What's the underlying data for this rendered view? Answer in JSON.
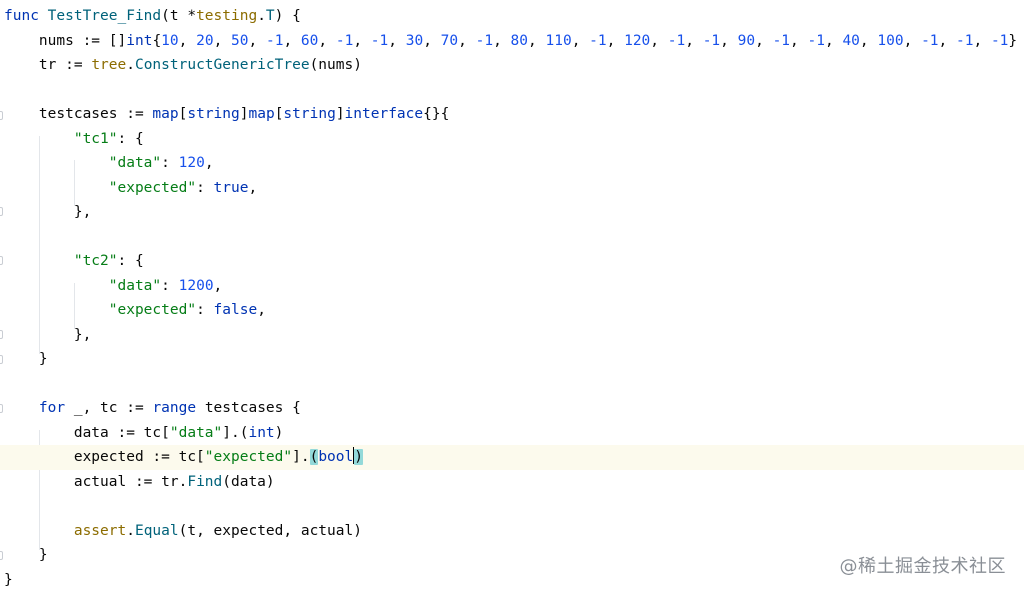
{
  "editor": {
    "lines": [
      {
        "indent": 0,
        "tokens": [
          [
            "kw",
            "func"
          ],
          [
            "plain",
            " "
          ],
          [
            "fn",
            "TestTree_Find"
          ],
          [
            "plain",
            "(t *"
          ],
          [
            "pkg",
            "testing"
          ],
          [
            "plain",
            "."
          ],
          [
            "fncall",
            "T"
          ],
          [
            "plain",
            ") {"
          ]
        ]
      },
      {
        "indent": 1,
        "tokens": [
          [
            "plain",
            "nums := []"
          ],
          [
            "type",
            "int"
          ],
          [
            "plain",
            "{"
          ],
          [
            "num",
            "10"
          ],
          [
            "plain",
            ", "
          ],
          [
            "num",
            "20"
          ],
          [
            "plain",
            ", "
          ],
          [
            "num",
            "50"
          ],
          [
            "plain",
            ", "
          ],
          [
            "num",
            "-1"
          ],
          [
            "plain",
            ", "
          ],
          [
            "num",
            "60"
          ],
          [
            "plain",
            ", "
          ],
          [
            "num",
            "-1"
          ],
          [
            "plain",
            ", "
          ],
          [
            "num",
            "-1"
          ],
          [
            "plain",
            ", "
          ],
          [
            "num",
            "30"
          ],
          [
            "plain",
            ", "
          ],
          [
            "num",
            "70"
          ],
          [
            "plain",
            ", "
          ],
          [
            "num",
            "-1"
          ],
          [
            "plain",
            ", "
          ],
          [
            "num",
            "80"
          ],
          [
            "plain",
            ", "
          ],
          [
            "num",
            "110"
          ],
          [
            "plain",
            ", "
          ],
          [
            "num",
            "-1"
          ],
          [
            "plain",
            ", "
          ],
          [
            "num",
            "120"
          ],
          [
            "plain",
            ", "
          ],
          [
            "num",
            "-1"
          ],
          [
            "plain",
            ", "
          ],
          [
            "num",
            "-1"
          ],
          [
            "plain",
            ", "
          ],
          [
            "num",
            "90"
          ],
          [
            "plain",
            ", "
          ],
          [
            "num",
            "-1"
          ],
          [
            "plain",
            ", "
          ],
          [
            "num",
            "-1"
          ],
          [
            "plain",
            ", "
          ],
          [
            "num",
            "40"
          ],
          [
            "plain",
            ", "
          ],
          [
            "num",
            "100"
          ],
          [
            "plain",
            ", "
          ],
          [
            "num",
            "-1"
          ],
          [
            "plain",
            ", "
          ],
          [
            "num",
            "-1"
          ],
          [
            "plain",
            ", "
          ],
          [
            "num",
            "-1"
          ],
          [
            "plain",
            "}"
          ]
        ]
      },
      {
        "indent": 1,
        "tokens": [
          [
            "plain",
            "tr := "
          ],
          [
            "pkg",
            "tree"
          ],
          [
            "plain",
            "."
          ],
          [
            "fncall",
            "ConstructGenericTree"
          ],
          [
            "plain",
            "(nums)"
          ]
        ]
      },
      {
        "indent": 0,
        "tokens": []
      },
      {
        "indent": 1,
        "tokens": [
          [
            "plain",
            "testcases := "
          ],
          [
            "kw",
            "map"
          ],
          [
            "plain",
            "["
          ],
          [
            "type",
            "string"
          ],
          [
            "plain",
            "]"
          ],
          [
            "kw",
            "map"
          ],
          [
            "plain",
            "["
          ],
          [
            "type",
            "string"
          ],
          [
            "plain",
            "]"
          ],
          [
            "kw",
            "interface"
          ],
          [
            "plain",
            "{}{"
          ]
        ]
      },
      {
        "indent": 2,
        "tokens": [
          [
            "str",
            "\"tc1\""
          ],
          [
            "plain",
            ": {"
          ]
        ]
      },
      {
        "indent": 3,
        "tokens": [
          [
            "str",
            "\"data\""
          ],
          [
            "plain",
            ": "
          ],
          [
            "num",
            "120"
          ],
          [
            "plain",
            ","
          ]
        ]
      },
      {
        "indent": 3,
        "tokens": [
          [
            "str",
            "\"expected\""
          ],
          [
            "plain",
            ": "
          ],
          [
            "kw",
            "true"
          ],
          [
            "plain",
            ","
          ]
        ]
      },
      {
        "indent": 2,
        "tokens": [
          [
            "plain",
            "},"
          ]
        ]
      },
      {
        "indent": 0,
        "tokens": []
      },
      {
        "indent": 2,
        "tokens": [
          [
            "str",
            "\"tc2\""
          ],
          [
            "plain",
            ": {"
          ]
        ]
      },
      {
        "indent": 3,
        "tokens": [
          [
            "str",
            "\"data\""
          ],
          [
            "plain",
            ": "
          ],
          [
            "num",
            "1200"
          ],
          [
            "plain",
            ","
          ]
        ]
      },
      {
        "indent": 3,
        "tokens": [
          [
            "str",
            "\"expected\""
          ],
          [
            "plain",
            ": "
          ],
          [
            "kw",
            "false"
          ],
          [
            "plain",
            ","
          ]
        ]
      },
      {
        "indent": 2,
        "tokens": [
          [
            "plain",
            "},"
          ]
        ]
      },
      {
        "indent": 1,
        "tokens": [
          [
            "plain",
            "}"
          ]
        ]
      },
      {
        "indent": 0,
        "tokens": []
      },
      {
        "indent": 1,
        "tokens": [
          [
            "kw",
            "for"
          ],
          [
            "plain",
            " _, tc := "
          ],
          [
            "kw",
            "range"
          ],
          [
            "plain",
            " testcases {"
          ]
        ]
      },
      {
        "indent": 2,
        "tokens": [
          [
            "plain",
            "data := tc["
          ],
          [
            "str",
            "\"data\""
          ],
          [
            "plain",
            "].("
          ],
          [
            "type",
            "int"
          ],
          [
            "plain",
            ")"
          ]
        ]
      },
      {
        "indent": 2,
        "current": true,
        "tokens": [
          [
            "plain",
            "expected := tc["
          ],
          [
            "str",
            "\"expected\""
          ],
          [
            "plain",
            "]."
          ],
          [
            "parenhl",
            "("
          ],
          [
            "type",
            "bool"
          ],
          [
            "caret",
            ""
          ],
          [
            "parenhl",
            ")"
          ]
        ]
      },
      {
        "indent": 2,
        "tokens": [
          [
            "plain",
            "actual := tr."
          ],
          [
            "fncall",
            "Find"
          ],
          [
            "plain",
            "(data)"
          ]
        ]
      },
      {
        "indent": 0,
        "tokens": []
      },
      {
        "indent": 2,
        "tokens": [
          [
            "pkg",
            "assert"
          ],
          [
            "plain",
            "."
          ],
          [
            "fncall",
            "Equal"
          ],
          [
            "plain",
            "(t, expected, actual)"
          ]
        ]
      },
      {
        "indent": 1,
        "tokens": [
          [
            "plain",
            "}"
          ]
        ]
      },
      {
        "indent": 0,
        "tokens": [
          [
            "plain",
            "}"
          ]
        ]
      }
    ]
  },
  "watermark": {
    "text": "@稀土掘金技术社区"
  }
}
